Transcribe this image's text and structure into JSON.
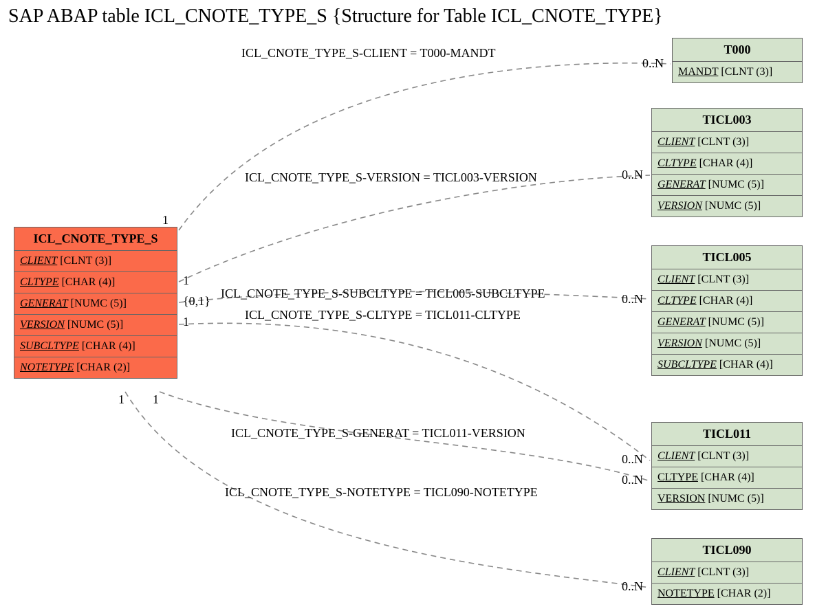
{
  "title": "SAP ABAP table ICL_CNOTE_TYPE_S {Structure for Table ICL_CNOTE_TYPE}",
  "main": {
    "name": "ICL_CNOTE_TYPE_S",
    "fields": [
      {
        "name": "CLIENT",
        "type": "[CLNT (3)]"
      },
      {
        "name": "CLTYPE",
        "type": "[CHAR (4)]"
      },
      {
        "name": "GENERAT",
        "type": "[NUMC (5)]"
      },
      {
        "name": "VERSION",
        "type": "[NUMC (5)]"
      },
      {
        "name": "SUBCLTYPE",
        "type": "[CHAR (4)]"
      },
      {
        "name": "NOTETYPE",
        "type": "[CHAR (2)]"
      }
    ]
  },
  "targets": {
    "t000": {
      "name": "T000",
      "fields": [
        {
          "name": "MANDT",
          "type": "[CLNT (3)]"
        }
      ]
    },
    "ticl003": {
      "name": "TICL003",
      "fields": [
        {
          "name": "CLIENT",
          "type": "[CLNT (3)]"
        },
        {
          "name": "CLTYPE",
          "type": "[CHAR (4)]"
        },
        {
          "name": "GENERAT",
          "type": "[NUMC (5)]"
        },
        {
          "name": "VERSION",
          "type": "[NUMC (5)]"
        }
      ]
    },
    "ticl005": {
      "name": "TICL005",
      "fields": [
        {
          "name": "CLIENT",
          "type": "[CLNT (3)]"
        },
        {
          "name": "CLTYPE",
          "type": "[CHAR (4)]"
        },
        {
          "name": "GENERAT",
          "type": "[NUMC (5)]"
        },
        {
          "name": "VERSION",
          "type": "[NUMC (5)]"
        },
        {
          "name": "SUBCLTYPE",
          "type": "[CHAR (4)]"
        }
      ]
    },
    "ticl011": {
      "name": "TICL011",
      "fields": [
        {
          "name": "CLIENT",
          "type": "[CLNT (3)]"
        },
        {
          "name": "CLTYPE",
          "type": "[CHAR (4)]"
        },
        {
          "name": "VERSION",
          "type": "[NUMC (5)]"
        }
      ]
    },
    "ticl090": {
      "name": "TICL090",
      "fields": [
        {
          "name": "CLIENT",
          "type": "[CLNT (3)]"
        },
        {
          "name": "NOTETYPE",
          "type": "[CHAR (2)]"
        }
      ]
    }
  },
  "edges": {
    "e1": "ICL_CNOTE_TYPE_S-CLIENT = T000-MANDT",
    "e2": "ICL_CNOTE_TYPE_S-VERSION = TICL003-VERSION",
    "e3": "ICL_CNOTE_TYPE_S-SUBCLTYPE = TICL005-SUBCLTYPE",
    "e4": "ICL_CNOTE_TYPE_S-CLTYPE = TICL011-CLTYPE",
    "e5": "ICL_CNOTE_TYPE_S-GENERAT = TICL011-VERSION",
    "e6": "ICL_CNOTE_TYPE_S-NOTETYPE = TICL090-NOTETYPE"
  },
  "card": {
    "c1l": "1",
    "c1r": "0..N",
    "c2l": "1",
    "c2r": "0..N",
    "c3l": "{0,1}",
    "c3r": "0..N",
    "c4l_top": "1",
    "c4l_bot": "1",
    "c5l": "1",
    "c5r": "0..N",
    "c6l": "1",
    "c6r": "0..N",
    "c7r": "0..N"
  }
}
